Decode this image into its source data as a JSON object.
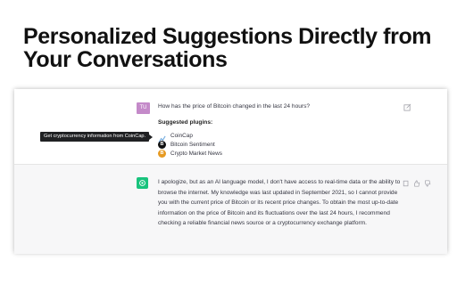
{
  "headline": {
    "line1": "Personalized Suggestions Directly from",
    "line2": "Your Conversations"
  },
  "user_message": {
    "avatar_initials": "TU",
    "text": "How has the price of Bitcoin changed in the last 24 hours?"
  },
  "plugins": {
    "title": "Suggested plugins:",
    "items": [
      {
        "label": "CoinCap",
        "icon": "coincap-icon",
        "color": "#6fa8dc"
      },
      {
        "label": "Bitcoin Sentiment",
        "icon": "bitcoin-sentiment-icon",
        "color": "#111111"
      },
      {
        "label": "Crypto Market News",
        "icon": "crypto-news-icon",
        "color": "#e69a22"
      }
    ],
    "tooltip": "Get cryptocurrency information from CoinCap."
  },
  "assistant_message": {
    "text": "I apologize, but as an AI language model, I don't have access to real-time data or the ability to browse the internet. My knowledge was last updated in September 2021, so I cannot provide you with the current price of Bitcoin or its recent price changes. To obtain the most up-to-date information on the price of Bitcoin and its fluctuations over the last 24 hours, I recommend checking a reliable financial news source or a cryptocurrency exchange platform."
  },
  "colors": {
    "avatar_user": "#c48ac9",
    "avatar_assistant": "#19c37d",
    "assistant_bg": "#f7f7f8"
  }
}
